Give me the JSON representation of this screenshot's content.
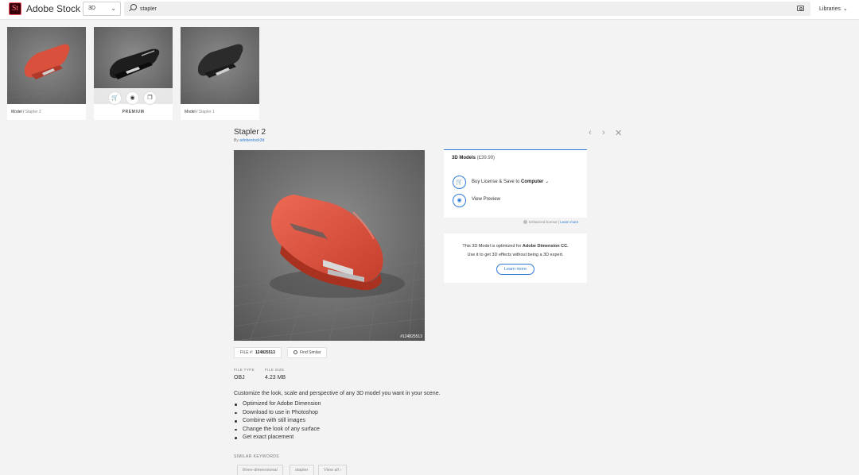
{
  "header": {
    "logo_text": "St",
    "brand": "Adobe Stock",
    "category": "3D",
    "search_value": "stapler",
    "libraries_label": "Libraries"
  },
  "thumbnails": [
    {
      "type": "Model",
      "name": "Stapler 2"
    },
    {
      "badge": "PREMIUM"
    },
    {
      "type": "Model",
      "name": "Stapler 1"
    }
  ],
  "detail": {
    "title": "Stapler 2",
    "by_label": "By",
    "author": "adobestock3d",
    "file_id_overlay": "#124825513",
    "file_label": "FILE #:",
    "file_number": "124825513",
    "find_similar": "Find Similar",
    "file_type_label": "FILE TYPE",
    "file_type": "OBJ",
    "file_size_label": "FILE SIZE",
    "file_size": "4.23 MB",
    "description": "Customize the look, scale and perspective of any 3D model you want in your scene.",
    "bullets": [
      "Optimized for Adobe Dimension",
      "Download to use in Photoshop",
      "Combine with still images",
      "Change the look of any surface",
      "Get exact placement"
    ],
    "similar_keywords_label": "SIMILAR KEYWORDS",
    "keywords": [
      "three-dimensional",
      "stapler"
    ],
    "view_all": "View all ›"
  },
  "purchase": {
    "heading": "3D Models",
    "price": "(£39.99)",
    "buy_label": "Buy License & Save to",
    "buy_target": "Computer",
    "preview_label": "View Preview",
    "license_text": "Enhanced license |",
    "license_link": "Learn more"
  },
  "dimension_promo": {
    "line1_prefix": "This 3D Model is optimized for",
    "line1_bold": "Adobe Dimension CC.",
    "line2": "Use it to get 3D effects without being a 3D expert.",
    "button": "Learn more"
  },
  "colors": {
    "accent": "#2d7ad6",
    "stapler_red": "#d9503c",
    "background": "#f3f3f3"
  }
}
